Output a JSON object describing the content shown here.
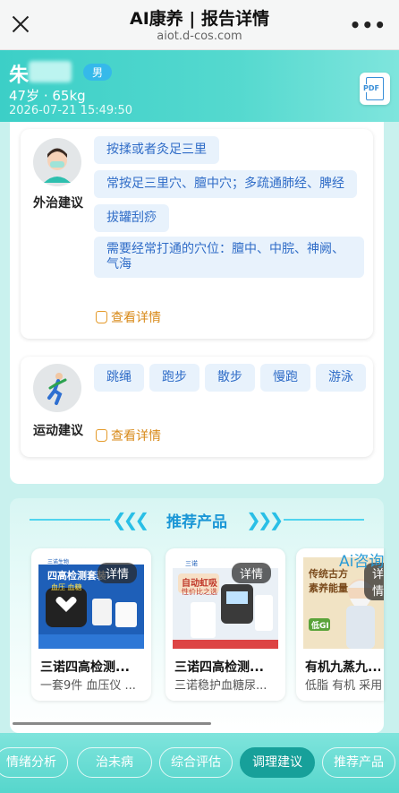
{
  "topbar": {
    "title": "AI康养 | 报告详情",
    "url": "aiot.d-cos.com",
    "more": "•••"
  },
  "user": {
    "name": "朱",
    "gender": "男",
    "age_weight": "47岁 · 65kg",
    "time": "2026-07-21 15:49:50",
    "pdf": "PDF"
  },
  "external": {
    "label": "外治建议",
    "chips": [
      "按揉或者灸足三里",
      "常按足三里穴、膻中穴；多疏通肺经、脾经",
      "拔罐刮痧",
      "需要经常打通的穴位：膻中、中脘、神阙、气海"
    ],
    "detail": "查看详情"
  },
  "exercise": {
    "label": "运动建议",
    "chips": [
      "跳绳",
      "跑步",
      "散步",
      "慢跑",
      "游泳"
    ],
    "detail": "查看详情"
  },
  "products": {
    "title": "推荐产品",
    "ai_consult": "Ai咨询",
    "items": [
      {
        "name": "三诺四高检测...",
        "desc": "一套9件 血压仪 ...",
        "btn": "详情",
        "img_title": "四高检测套装",
        "img_tags": "血压  血糖",
        "brand": "三诺生物"
      },
      {
        "name": "三诺四高检测...",
        "desc": "三诺稳护血糖尿...",
        "btn": "详情",
        "img_title": "自动虹吸",
        "img_sub": "性价比之选",
        "brand": "三诺"
      },
      {
        "name": "有机九蒸九...",
        "desc": "低脂 有机 采用...",
        "btn": "详情",
        "img_title": "传统古方",
        "img_sub": "素养能量",
        "brand": "低GI"
      }
    ]
  },
  "tabs": [
    {
      "label": "情绪分析",
      "active": false
    },
    {
      "label": "治未病",
      "active": false
    },
    {
      "label": "综合评估",
      "active": false
    },
    {
      "label": "调理建议",
      "active": true
    },
    {
      "label": "推荐产品",
      "active": false
    }
  ],
  "colors": {
    "accent": "#3ccfc7",
    "chip_bg": "#e8f2fc",
    "chip_text": "#2f6cc7",
    "detail": "#d88a1a",
    "tab_active": "#17a09a"
  }
}
